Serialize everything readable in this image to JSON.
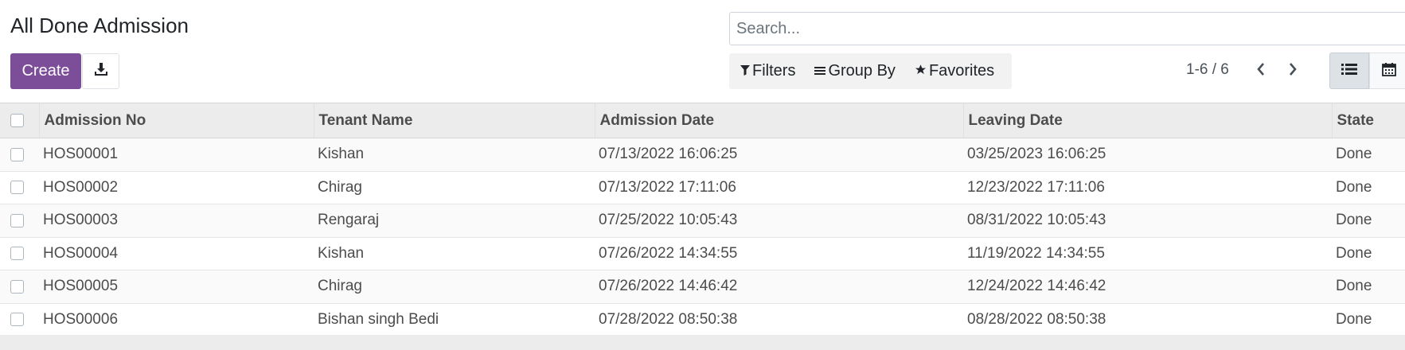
{
  "page": {
    "title": "All Done Admission"
  },
  "actions": {
    "create_label": "Create",
    "download_icon": "download-icon"
  },
  "search": {
    "placeholder": "Search...",
    "value": ""
  },
  "filters": {
    "filters_label": "Filters",
    "group_by_label": "Group By",
    "favorites_label": "Favorites"
  },
  "pager": {
    "text": "1-6 / 6"
  },
  "views": [
    "list",
    "calendar"
  ],
  "table": {
    "columns": [
      "Admission No",
      "Tenant Name",
      "Admission Date",
      "Leaving Date",
      "State"
    ],
    "rows": [
      [
        "HOS00001",
        "Kishan",
        "07/13/2022 16:06:25",
        "03/25/2023 16:06:25",
        "Done"
      ],
      [
        "HOS00002",
        "Chirag",
        "07/13/2022 17:11:06",
        "12/23/2022 17:11:06",
        "Done"
      ],
      [
        "HOS00003",
        "Rengaraj",
        "07/25/2022 10:05:43",
        "08/31/2022 10:05:43",
        "Done"
      ],
      [
        "HOS00004",
        "Kishan",
        "07/26/2022 14:34:55",
        "11/19/2022 14:34:55",
        "Done"
      ],
      [
        "HOS00005",
        "Chirag",
        "07/26/2022 14:46:42",
        "12/24/2022 14:46:42",
        "Done"
      ],
      [
        "HOS00006",
        "Bishan singh Bedi",
        "07/28/2022 08:50:38",
        "08/28/2022 08:50:38",
        "Done"
      ]
    ]
  },
  "colors": {
    "primary": "#7c4d99",
    "header_bg": "#ececec",
    "filter_bg": "#f2f2f2"
  }
}
